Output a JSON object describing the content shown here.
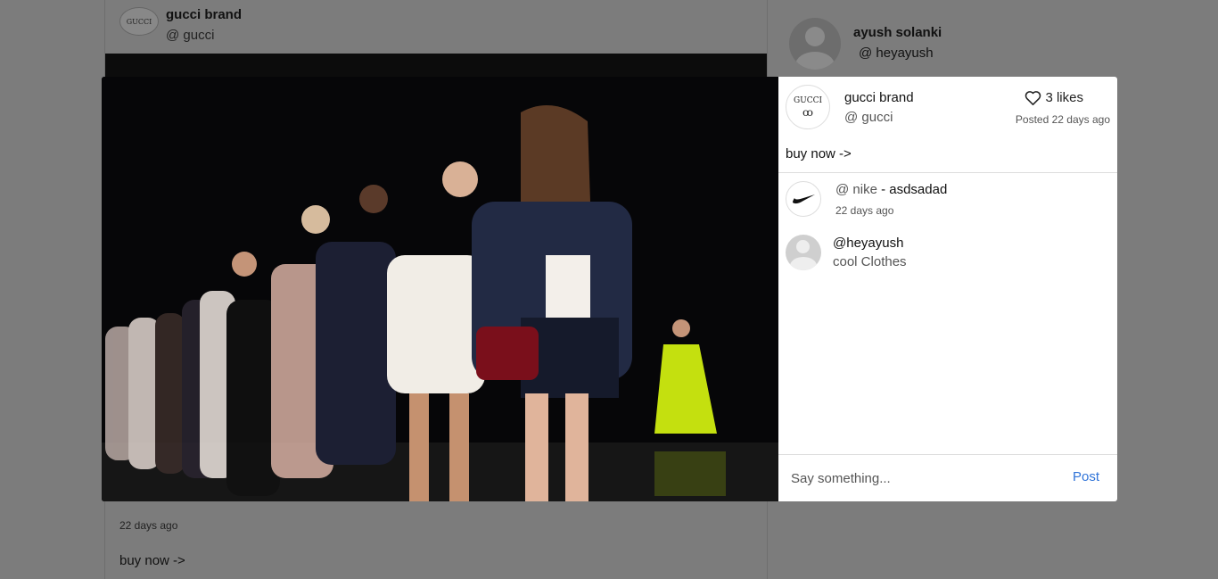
{
  "feed": {
    "brand_logo_text": "GUCCI",
    "brand_name": "gucci brand",
    "brand_handle": "@ gucci",
    "time": "22 days ago",
    "caption": "buy now ->"
  },
  "profile": {
    "name": "ayush solanki",
    "handle": "@ heyayush",
    "avatar_icon": "user-avatar-icon"
  },
  "modal": {
    "post": {
      "brand_logo_text": "GUCCI",
      "brand_logo_symbol": "ꝏ",
      "brand_name": "gucci brand",
      "brand_handle": "@ gucci",
      "likes": "3 likes",
      "posted": "Posted 22 days ago",
      "caption": "buy now ->"
    },
    "comments": [
      {
        "avatar_logo": "NIKE",
        "user": "@ nike",
        "text": " - asdsadad",
        "time": "22 days ago"
      },
      {
        "user": "@heyayush",
        "text": "cool Clothes"
      }
    ],
    "input": {
      "placeholder": "Say something...",
      "post_label": "Post"
    },
    "colors": {
      "post_link": "#2f73d8",
      "overlay": "#7c7c7c"
    }
  }
}
